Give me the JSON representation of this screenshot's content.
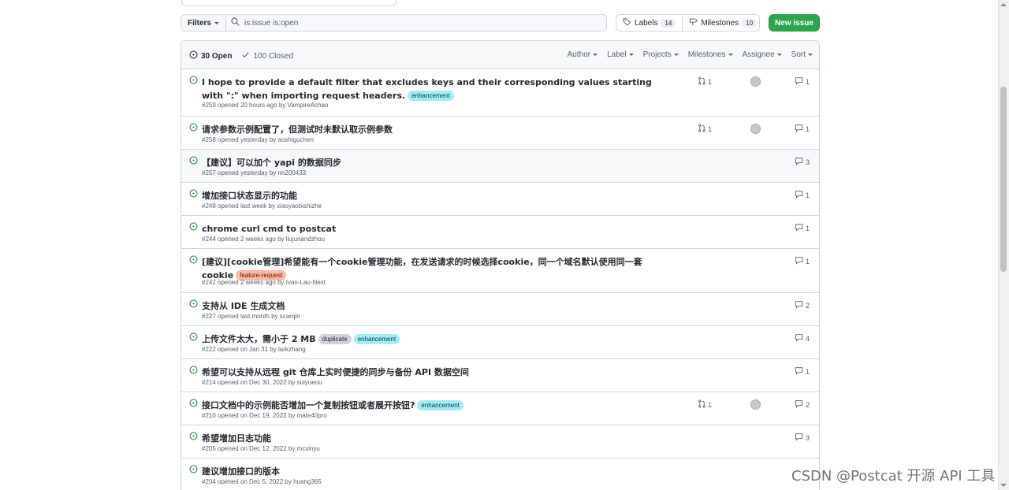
{
  "toolbar": {
    "filters_label": "Filters",
    "search_placeholder": "is:issue is:open",
    "search_value": "is:issue is:open",
    "labels_label": "Labels",
    "labels_count": "14",
    "milestones_label": "Milestones",
    "milestones_count": "10",
    "new_issue_label": "New issue"
  },
  "header": {
    "open_label": "30 Open",
    "closed_label": "100 Closed",
    "filters": [
      "Author",
      "Label",
      "Projects",
      "Milestones",
      "Assignee",
      "Sort"
    ]
  },
  "issues": [
    {
      "title": "I hope to provide a default filter that excludes keys and their corresponding values starting with \":\" when importing request headers.",
      "labels": [
        "enhancement"
      ],
      "meta": "#259 opened 20 hours ago by VampireAchao",
      "pr": "1",
      "comments": "1",
      "avatar": true
    },
    {
      "title": "请求参数示例配置了，但测试时未默认取示例参数",
      "labels": [],
      "meta": "#258 opened yesterday by aoshiguchen",
      "pr": "1",
      "comments": "1",
      "avatar": true
    },
    {
      "title": "【建议】可以加个 yapi 的数据同步",
      "labels": [],
      "meta": "#257 opened yesterday by nn200433",
      "pr": "",
      "comments": "3",
      "avatar": false
    },
    {
      "title": "增加接口状态显示的功能",
      "labels": [],
      "meta": "#248 opened last week by xiaoyaobishizhe",
      "pr": "",
      "comments": "1",
      "avatar": false
    },
    {
      "title": "chrome curl cmd to postcat",
      "labels": [],
      "meta": "#244 opened 2 weeks ago by liujunandzhou",
      "pr": "",
      "comments": "1",
      "avatar": false
    },
    {
      "title": "[建议][cookie管理]希望能有一个cookie管理功能，在发送请求的时候选择cookie，同一个域名默认使用同一套cookie",
      "labels": [
        "feature-request"
      ],
      "meta": "#242 opened 2 weeks ago by Ivan-Lau-Next",
      "pr": "",
      "comments": "1",
      "avatar": false
    },
    {
      "title": "支持从 IDE 生成文档",
      "labels": [],
      "meta": "#227 opened last month by scarqin",
      "pr": "",
      "comments": "2",
      "avatar": false
    },
    {
      "title": "上传文件太大，需小于 2 MB",
      "labels": [
        "duplicate",
        "enhancement"
      ],
      "meta": "#222 opened on Jan 31 by larkzhang",
      "pr": "",
      "comments": "4",
      "avatar": false
    },
    {
      "title": "希望可以支持从远程 git 仓库上实时便捷的同步与备份 API 数据空间",
      "labels": [],
      "meta": "#214 opened on Dec 30, 2022 by suiyueou",
      "pr": "",
      "comments": "1",
      "avatar": false
    },
    {
      "title": "接口文档中的示例能否增加一个复制按钮或者展开按钮?",
      "labels": [
        "enhancement"
      ],
      "meta": "#210 opened on Dec 19, 2022 by mate40pro",
      "pr": "1",
      "comments": "2",
      "avatar": true
    },
    {
      "title": "希望增加日志功能",
      "labels": [],
      "meta": "#205 opened on Dec 12, 2022 by mcxinyu",
      "pr": "",
      "comments": "3",
      "avatar": false
    },
    {
      "title": "建议增加接口的版本",
      "labels": [],
      "meta": "#204 opened on Dec 5, 2022 by huang365",
      "pr": "",
      "comments": "",
      "avatar": false
    }
  ],
  "watermark": "CSDN @Postcat 开源 API 工具",
  "colors": {
    "open_green": "#1a7f37",
    "primary": "#2da44e",
    "enhancement": "#a2eeef",
    "feature_request": "#f9b9a4",
    "duplicate": "#cfd3d7"
  }
}
